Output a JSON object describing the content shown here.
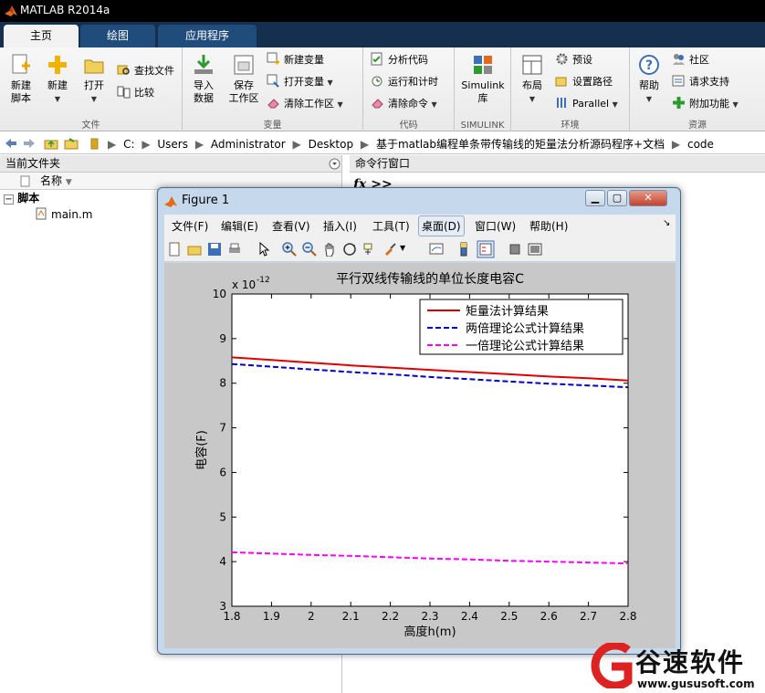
{
  "window": {
    "title": "MATLAB R2014a"
  },
  "tabs": [
    {
      "label": "主页"
    },
    {
      "label": "绘图"
    },
    {
      "label": "应用程序"
    }
  ],
  "ribbon": {
    "file": {
      "label": "文件",
      "new_script": [
        "新建",
        "脚本"
      ],
      "new": "新建",
      "open": "打开",
      "find_files": "查找文件",
      "compare": "比较"
    },
    "variable": {
      "label": "变量",
      "import": [
        "导入",
        "数据"
      ],
      "save": [
        "保存",
        "工作区"
      ],
      "new_var": "新建变量",
      "open_var": "打开变量",
      "clear_ws": "清除工作区"
    },
    "code": {
      "label": "代码",
      "analyze": "分析代码",
      "run_time": "运行和计时",
      "clear_cmd": "清除命令"
    },
    "simulink": {
      "label": "SIMULINK",
      "lib": [
        "Simulink",
        "库"
      ]
    },
    "environment": {
      "label": "环境",
      "layout": "布局",
      "prefs": "预设",
      "set_path": "设置路径",
      "parallel": "Parallel"
    },
    "resources": {
      "label": "资源",
      "help": "帮助",
      "community": "社区",
      "support": "请求支持",
      "addons": "附加功能"
    }
  },
  "address": {
    "crumbs": [
      "C:",
      "Users",
      "Administrator",
      "Desktop",
      "基于matlab编程单条带传输线的矩量法分析源码程序+文档",
      "code"
    ]
  },
  "current_folder": {
    "title": "当前文件夹",
    "col_name": "名称",
    "group": "脚本",
    "file": "main.m"
  },
  "command_window": {
    "title": "命令行窗口",
    "prompt": "fx >>"
  },
  "figure": {
    "title": "Figure 1",
    "menu": [
      "文件(F)",
      "编辑(E)",
      "查看(V)",
      "插入(I)",
      "工具(T)",
      "桌面(D)",
      "窗口(W)",
      "帮助(H)"
    ]
  },
  "colors": {
    "series_1": "#e00000",
    "series_2": "#0000c8",
    "series_3": "#ff00ff"
  },
  "chart_data": {
    "type": "line",
    "title": "平行双线传输线的单位长度电容C",
    "xlabel": "高度h(m)",
    "ylabel": "电容(F)",
    "y_exponent": "x 10",
    "y_exponent_power": "-12",
    "xlim": [
      1.8,
      2.8
    ],
    "ylim": [
      3,
      10
    ],
    "xticks": [
      "1.8",
      "1.9",
      "2",
      "2.1",
      "2.2",
      "2.3",
      "2.4",
      "2.5",
      "2.6",
      "2.7",
      "2.8"
    ],
    "yticks": [
      "3",
      "4",
      "5",
      "6",
      "7",
      "8",
      "9",
      "10"
    ],
    "legend_position": "top-right",
    "grid": false,
    "x": [
      1.8,
      1.9,
      2.0,
      2.1,
      2.2,
      2.3,
      2.4,
      2.5,
      2.6,
      2.7,
      2.8
    ],
    "series": [
      {
        "name": "矩量法计算结果",
        "style": "solid",
        "values": [
          8.58,
          8.52,
          8.46,
          8.4,
          8.35,
          8.3,
          8.25,
          8.2,
          8.15,
          8.11,
          8.06
        ]
      },
      {
        "name": "两倍理论公式计算结果",
        "style": "dashed",
        "values": [
          8.43,
          8.37,
          8.31,
          8.25,
          8.2,
          8.14,
          8.09,
          8.04,
          7.99,
          7.95,
          7.91
        ]
      },
      {
        "name": "一倍理论公式计算结果",
        "style": "dashed",
        "values": [
          4.21,
          4.18,
          4.15,
          4.13,
          4.1,
          4.07,
          4.05,
          4.02,
          4.0,
          3.98,
          3.96
        ]
      }
    ]
  },
  "watermark": {
    "name": "谷速软件",
    "url": "www.gususoft.com"
  }
}
